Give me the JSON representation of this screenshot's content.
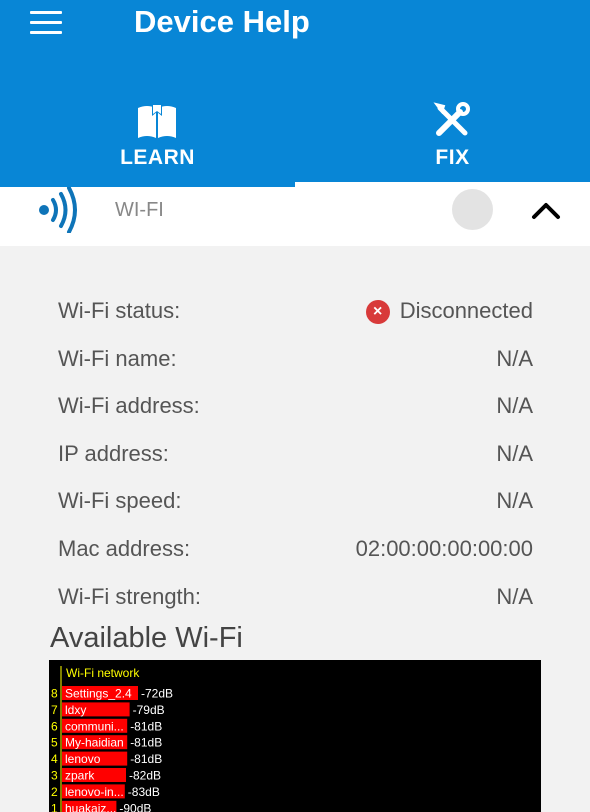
{
  "app": {
    "title": "Device Help"
  },
  "tabs": [
    {
      "label": "LEARN",
      "icon": "book-icon",
      "selected": false
    },
    {
      "label": "FIX",
      "icon": "tools-icon",
      "selected": true
    }
  ],
  "section": {
    "label": "WI-FI",
    "icon": "wifi-signal-icon",
    "toggle_on": false,
    "expanded": true
  },
  "info": [
    {
      "label": "Wi-Fi status:",
      "value": "Disconnected",
      "status_icon": "error-x-icon"
    },
    {
      "label": "Wi-Fi name:",
      "value": "N/A"
    },
    {
      "label": "Wi-Fi address:",
      "value": "N/A"
    },
    {
      "label": "IP address:",
      "value": "N/A"
    },
    {
      "label": "Wi-Fi speed:",
      "value": "N/A"
    },
    {
      "label": "Mac address:",
      "value": "02:00:00:00:00:00"
    },
    {
      "label": "Wi-Fi strength:",
      "value": "N/A"
    }
  ],
  "available": {
    "title": "Available Wi-Fi"
  },
  "chart_data": {
    "type": "bar",
    "title": "Wi-Fi network",
    "orientation": "horizontal",
    "categories": [
      "Settings_2.4",
      "ldxy",
      "communi...",
      "My-haidian",
      "lenovo",
      "zpark",
      "lenovo-in...",
      "huakaiz..."
    ],
    "ranks": [
      "8",
      "7",
      "6",
      "5",
      "4",
      "3",
      "2",
      "1"
    ],
    "values": [
      -72,
      -79,
      -81,
      -81,
      -81,
      -82,
      -83,
      -90
    ],
    "value_labels": [
      "-72dB",
      "-79dB",
      "-81dB",
      "-81dB",
      "-81dB",
      "-82dB",
      "-83dB",
      "-90dB"
    ],
    "unit": "dB",
    "colors": {
      "bar": "#ff0000",
      "background": "#000000",
      "title": "#ffff00",
      "rank": "#ffff00",
      "text": "#ffffff"
    }
  },
  "colors": {
    "accent": "#0886d6",
    "error": "#d83a3a"
  }
}
